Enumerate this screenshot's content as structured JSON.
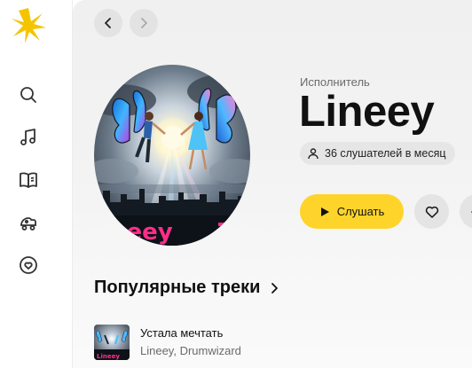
{
  "sidebar": {
    "logo_icon": "yandex-music-sun-logo",
    "items": [
      {
        "icon": "search-icon"
      },
      {
        "icon": "music-note-icon"
      },
      {
        "icon": "book-icon"
      },
      {
        "icon": "baby-car-icon"
      },
      {
        "icon": "heart-icon"
      }
    ]
  },
  "header": {
    "back_icon": "chevron-left-icon",
    "forward_icon": "chevron-right-icon"
  },
  "artist": {
    "type_label": "Исполнитель",
    "name": "Lineey",
    "listeners": "36 слушателей в месяц",
    "cover_text": "neey"
  },
  "actions": {
    "play_label": "Слушать",
    "accent_color": "#fed42b"
  },
  "popular": {
    "title": "Популярные треки",
    "tracks": [
      {
        "title": "Устала мечтать",
        "artists": "Lineey, Drumwizard",
        "cover_text": "Lineey"
      }
    ]
  }
}
